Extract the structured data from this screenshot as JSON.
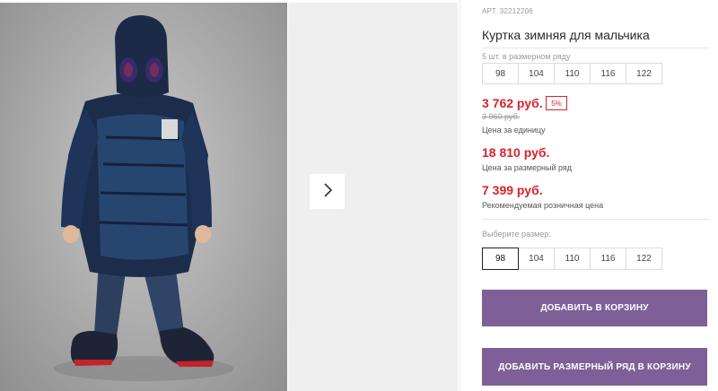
{
  "product": {
    "sku": "АРТ. 32212206",
    "title": "Куртка зимняя для мальчика",
    "image_alt": "Мальчик в тёмно-синей зимней куртке с капюшоном"
  },
  "gallery": {
    "next_icon": "chevron-right-icon"
  },
  "pack": {
    "label": "5 шт. в размерном ряду",
    "sizes": [
      "98",
      "104",
      "110",
      "116",
      "122"
    ]
  },
  "pricing": {
    "unit_price": "3 762 руб.",
    "discount": "5%",
    "old_price": "3 960 руб.",
    "unit_caption": "Цена за единицу",
    "pack_price": "18 810 руб.",
    "pack_caption": "Цена за размерный ряд",
    "retail_price": "7 399 руб.",
    "retail_caption": "Рекомендуемая розничная цена"
  },
  "size_select": {
    "label": "Выберите размер:",
    "sizes": [
      "98",
      "104",
      "110",
      "116",
      "122"
    ],
    "selected": "98"
  },
  "actions": {
    "add_to_cart": "ДОБАВИТЬ В КОРЗИНУ",
    "add_pack_to_cart": "ДОБАВИТЬ РАЗМЕРНЫЙ РЯД В КОРЗИНУ"
  },
  "colors": {
    "accent": "#7e5f97",
    "price_red": "#d8232a"
  }
}
